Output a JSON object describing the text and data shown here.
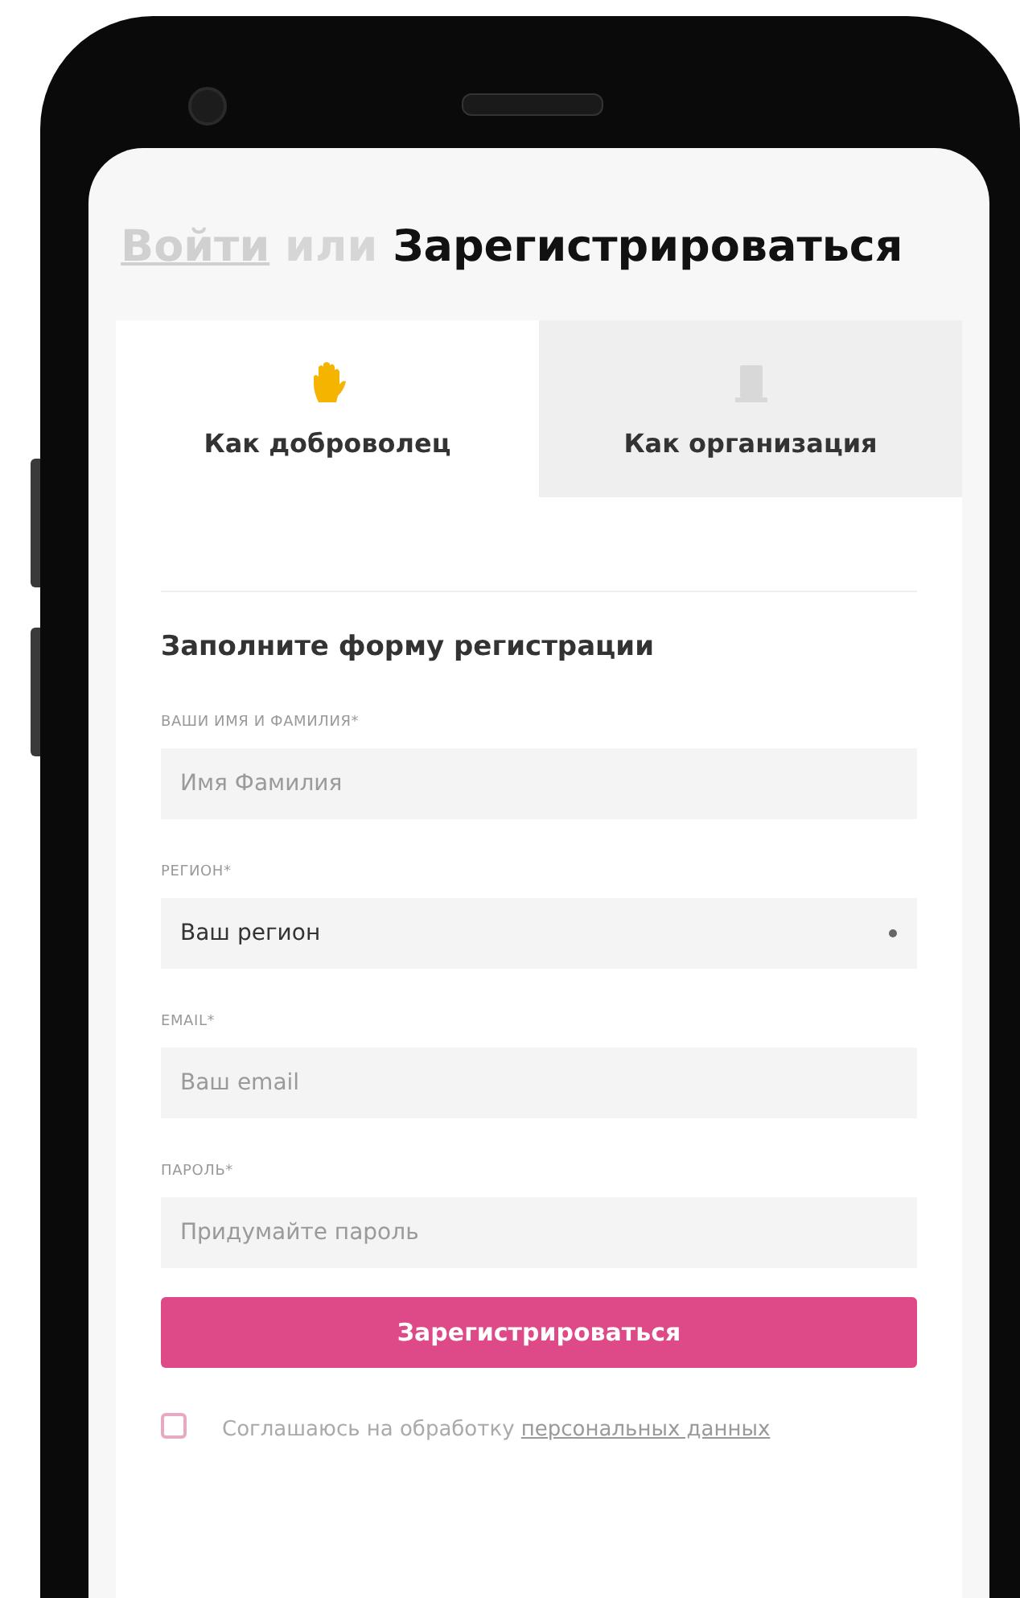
{
  "header": {
    "login_link": "Войти",
    "separator": "или",
    "title": "Зарегистрироваться"
  },
  "tabs": [
    {
      "kind": "hand",
      "label": "Как доброволец",
      "selected": true
    },
    {
      "kind": "document",
      "label": "Как организация",
      "selected": false
    }
  ],
  "form": {
    "heading": "Заполните форму регистрации",
    "fields": [
      {
        "kind": "text",
        "label": "ВАШИ ИМЯ И ФАМИЛИЯ*",
        "placeholder": "Имя Фамилия"
      },
      {
        "kind": "select",
        "label": "РЕГИОН*",
        "value": "Ваш регион"
      },
      {
        "kind": "text",
        "label": "EMAIL*",
        "placeholder": "Ваш email"
      },
      {
        "kind": "password",
        "label": "ПАРОЛЬ*",
        "placeholder": "Придумайте пароль"
      }
    ],
    "submit": "Зарегистрироваться",
    "consent": {
      "text": "Соглашаюсь на обработку ",
      "link": "персональных данных",
      "checked": false
    }
  }
}
